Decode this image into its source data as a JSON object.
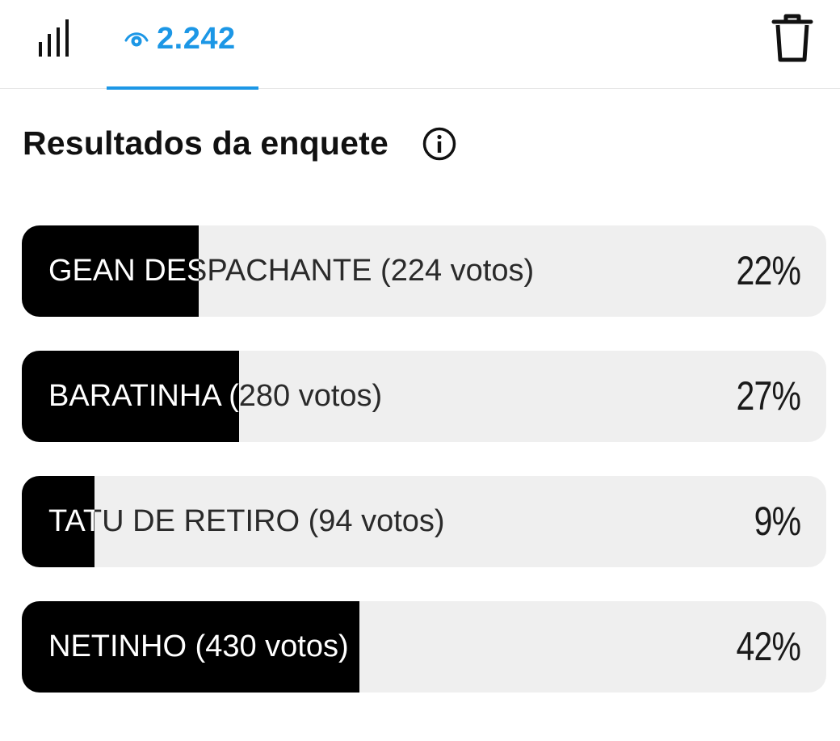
{
  "header": {
    "stats_icon": "bar-chart-icon",
    "views_icon": "eye-icon",
    "views_count": "2.242",
    "delete_icon": "trash-icon",
    "accent_color": "#1c97e6"
  },
  "title": {
    "text": "Resultados da enquete",
    "info_icon": "info-icon"
  },
  "poll": {
    "options": [
      {
        "label": "GEAN DESPACHANTE (224 votos)",
        "votes": 224,
        "percent_label": "22%",
        "fill_fraction": 0.22
      },
      {
        "label": "BARATINHA (280 votos)",
        "votes": 280,
        "percent_label": "27%",
        "fill_fraction": 0.27
      },
      {
        "label": "TATU DE RETIRO (94 votos)",
        "votes": 94,
        "percent_label": "9%",
        "fill_fraction": 0.09
      },
      {
        "label": "NETINHO (430 votos)",
        "votes": 430,
        "percent_label": "42%",
        "fill_fraction": 0.42
      }
    ],
    "fill_color": "#000000",
    "track_color": "#efefef"
  }
}
